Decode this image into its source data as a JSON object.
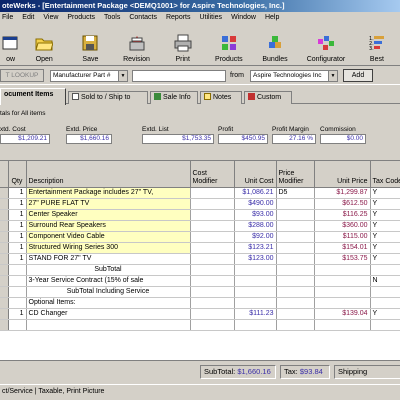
{
  "window": {
    "title": "oteWerks - [Entertainment Package <DEMQ1001> for Aspire Technologies, Inc.]"
  },
  "menu": [
    "File",
    "Edit",
    "View",
    "Products",
    "Tools",
    "Contacts",
    "Reports",
    "Utilities",
    "Window",
    "Help"
  ],
  "toolbar": [
    {
      "label": "ow",
      "icon": "window-icon"
    },
    {
      "label": "Open",
      "icon": "folder-open-icon"
    },
    {
      "label": "Save",
      "icon": "floppy-disk-icon"
    },
    {
      "label": "Revision",
      "icon": "revision-icon"
    },
    {
      "label": "Print",
      "icon": "printer-icon"
    },
    {
      "label": "Products",
      "icon": "products-icon"
    },
    {
      "label": "Bundles",
      "icon": "bundles-icon"
    },
    {
      "label": "Configurator",
      "icon": "configurator-icon"
    },
    {
      "label": "Best",
      "icon": "best-ranking-icon"
    }
  ],
  "lookup": {
    "button": "T LOOKUP",
    "field_select": "Manufacturer Part #",
    "search_value": "",
    "from_label": "from",
    "vendor_select": "Aspire Technologies Inc",
    "add_button": "Add"
  },
  "tabs": [
    {
      "label": "ocument Items",
      "active": true
    },
    {
      "label": "Sold to / Ship to",
      "active": false
    },
    {
      "label": "Sale Info",
      "active": false
    },
    {
      "label": "Notes",
      "active": false
    },
    {
      "label": "Custom",
      "active": false
    }
  ],
  "totals": {
    "heading": "tals for All items",
    "columns": [
      {
        "caption": "xtd. Cost",
        "value": "$1,209.21"
      },
      {
        "caption": "Extd. Price",
        "value": "$1,660.16"
      },
      {
        "caption": "Extd. List",
        "value": "$1,753.35"
      },
      {
        "caption": "Profit",
        "value": "$450.95"
      },
      {
        "caption": "Profit Margin",
        "value": "27.16 %"
      },
      {
        "caption": "Commission",
        "value": "$0.00"
      }
    ]
  },
  "grid": {
    "headers": [
      "",
      "Qty",
      "Description",
      "Cost Modifier",
      "Unit Cost",
      "Price Modifier",
      "Unit Price",
      "Tax Code"
    ],
    "rows": [
      {
        "qty": "1",
        "desc": "Entertainment Package includes 27\" TV,",
        "cost_mod": "",
        "unit_cost": "$1,086.21",
        "price_mod": "D5",
        "unit_price": "$1,299.87",
        "tax": "Y",
        "style": "hl"
      },
      {
        "qty": "1",
        "desc": "27\" PURE FLAT TV",
        "cost_mod": "",
        "unit_cost": "$490.00",
        "price_mod": "",
        "unit_price": "$612.50",
        "tax": "Y",
        "style": "hl"
      },
      {
        "qty": "1",
        "desc": "Center Speaker",
        "cost_mod": "",
        "unit_cost": "$93.00",
        "price_mod": "",
        "unit_price": "$116.25",
        "tax": "Y",
        "style": "hl"
      },
      {
        "qty": "1",
        "desc": "Surround Rear Speakers",
        "cost_mod": "",
        "unit_cost": "$288.00",
        "price_mod": "",
        "unit_price": "$360.00",
        "tax": "Y",
        "style": "hl"
      },
      {
        "qty": "1",
        "desc": "Component Video Cable",
        "cost_mod": "",
        "unit_cost": "$92.00",
        "price_mod": "",
        "unit_price": "$115.00",
        "tax": "Y",
        "style": "hl"
      },
      {
        "qty": "1",
        "desc": "Structured Wiring Series 300",
        "cost_mod": "",
        "unit_cost": "$123.21",
        "price_mod": "",
        "unit_price": "$154.01",
        "tax": "Y",
        "style": "hl"
      },
      {
        "qty": "1",
        "desc": "STAND FOR 27\" TV",
        "cost_mod": "",
        "unit_cost": "$123.00",
        "price_mod": "",
        "unit_price": "$153.75",
        "tax": "Y",
        "style": ""
      },
      {
        "qty": "",
        "desc": "SubTotal",
        "cost_mod": "",
        "unit_cost": "",
        "price_mod": "",
        "unit_price": "",
        "tax": "",
        "style": "ctr"
      },
      {
        "qty": "",
        "desc": "3-Year Service Contract (15% of sale",
        "cost_mod": "",
        "unit_cost": "",
        "price_mod": "",
        "unit_price": "",
        "tax": "N",
        "style": ""
      },
      {
        "qty": "",
        "desc": "SubTotal Including Service",
        "cost_mod": "",
        "unit_cost": "",
        "price_mod": "",
        "unit_price": "",
        "tax": "",
        "style": "ctr"
      },
      {
        "qty": "",
        "desc": "Optional Items:",
        "cost_mod": "",
        "unit_cost": "",
        "price_mod": "",
        "unit_price": "",
        "tax": "",
        "style": ""
      },
      {
        "qty": "1",
        "desc": "CD Changer",
        "cost_mod": "",
        "unit_cost": "$111.23",
        "price_mod": "",
        "unit_price": "$139.04",
        "tax": "Y",
        "style": ""
      },
      {
        "qty": "",
        "desc": "",
        "cost_mod": "",
        "unit_cost": "",
        "price_mod": "",
        "unit_price": "",
        "tax": "",
        "style": ""
      }
    ]
  },
  "bottombar": {
    "subtotal_label": "SubTotal:",
    "subtotal_value": "$1,660.16",
    "tax_label": "Tax:",
    "tax_value": "$93.84",
    "shipping_label": "Shipping"
  },
  "status": {
    "text": "ct/Service | Taxable, Print Picture"
  },
  "colors": {
    "value_blue": "#3a2ea8",
    "price_red": "#8b1a4a",
    "highlight_yellow": "#ffffc0",
    "title_navy": "#0a246a"
  }
}
